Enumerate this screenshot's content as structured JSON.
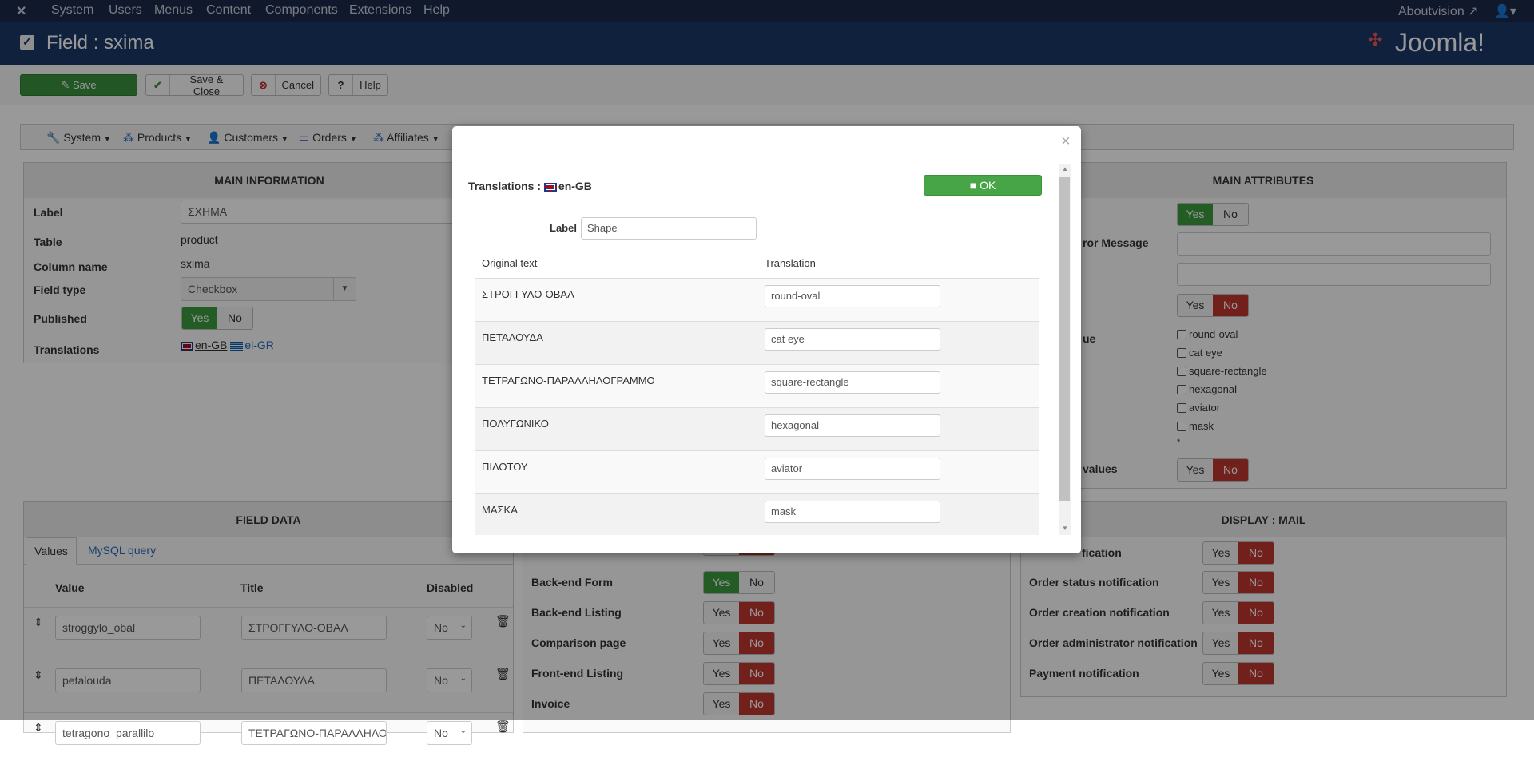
{
  "topbar": {
    "menu": [
      "System",
      "Users",
      "Menus",
      "Content",
      "Components",
      "Extensions",
      "Help"
    ],
    "site_link": "Aboutvision"
  },
  "header": {
    "title": "Field : sxima",
    "brand": "Joomla!"
  },
  "toolbar": {
    "save": "Save",
    "save_close": "Save & Close",
    "cancel": "Cancel",
    "help": "Help"
  },
  "submenu": [
    "System",
    "Products",
    "Customers",
    "Orders",
    "Affiliates"
  ],
  "main_info": {
    "title": "MAIN INFORMATION",
    "label_l": "Label",
    "label_v": "ΣΧΗΜΑ",
    "table_l": "Table",
    "table_v": "product",
    "column_l": "Column name",
    "column_v": "sxima",
    "type_l": "Field type",
    "type_v": "Checkbox",
    "published_l": "Published",
    "translations_l": "Translations",
    "tr_en": "en-GB",
    "tr_el": "el-GR",
    "yes": "Yes",
    "no": "No"
  },
  "main_attr": {
    "title": "MAIN ATTRIBUTES",
    "error_label": "ror Message",
    "default_label": "ue",
    "values_label": "values",
    "options": [
      "round-oval",
      "cat eye",
      "square-rectangle",
      "hexagonal",
      "aviator",
      "mask"
    ],
    "required_mark": "*",
    "yes": "Yes",
    "no": "No"
  },
  "field_data": {
    "title": "FIELD DATA",
    "tabs": [
      "Values",
      "MySQL query"
    ],
    "headers": [
      "Value",
      "Title",
      "Disabled"
    ],
    "rows": [
      {
        "value": "stroggylo_obal",
        "title": "ΣΤΡΟΓΓΥΛΟ-ΟΒΑΛ",
        "disabled": "No"
      },
      {
        "value": "petalouda",
        "title": "ΠΕΤΑΛΟΥΔΑ",
        "disabled": "No"
      },
      {
        "value": "tetragono_parallilo",
        "title": "ΤΕΤΡΑΓΩΝΟ-ΠΑΡΑΛΛΗΛΟΓ",
        "disabled": "No"
      }
    ]
  },
  "display": {
    "rows": [
      {
        "label": "Back-end Form",
        "value": "Yes"
      },
      {
        "label": "Back-end Listing",
        "value": "No"
      },
      {
        "label": "Comparison page",
        "value": "No"
      },
      {
        "label": "Front-end Listing",
        "value": "No"
      },
      {
        "label": "Invoice",
        "value": "No"
      }
    ],
    "yes": "Yes",
    "no": "No"
  },
  "display_mail": {
    "title": "DISPLAY : MAIL",
    "rows": [
      {
        "label": "fication",
        "value": "No"
      },
      {
        "label": "Order status notification",
        "value": "No"
      },
      {
        "label": "Order creation notification",
        "value": "No"
      },
      {
        "label": "Order administrator notification",
        "value": "No"
      },
      {
        "label": "Payment notification",
        "value": "No"
      }
    ],
    "yes": "Yes",
    "no": "No"
  },
  "modal": {
    "title": "Translations : ",
    "lang": "en-GB",
    "ok": "OK",
    "label_l": "Label",
    "label_v": "Shape",
    "col_original": "Original text",
    "col_translation": "Translation",
    "rows": [
      {
        "original": "ΣΤΡΟΓΓΥΛΟ-ΟΒΑΛ",
        "translation": "round-oval"
      },
      {
        "original": "ΠΕΤΑΛΟΥΔΑ",
        "translation": "cat eye"
      },
      {
        "original": "ΤΕΤΡΑΓΩΝΟ-ΠΑΡΑΛΛΗΛΟΓΡΑΜΜΟ",
        "translation": "square-rectangle"
      },
      {
        "original": "ΠΟΛΥΓΩΝΙΚΟ",
        "translation": "hexagonal"
      },
      {
        "original": "ΠΙΛΟΤΟΥ",
        "translation": "aviator"
      },
      {
        "original": "ΜΑΣΚΑ",
        "translation": "mask"
      }
    ]
  },
  "colors": {
    "green": "#3c9a3f",
    "red": "#bd362f",
    "header": "#1a3867",
    "ok": "#47a447"
  }
}
